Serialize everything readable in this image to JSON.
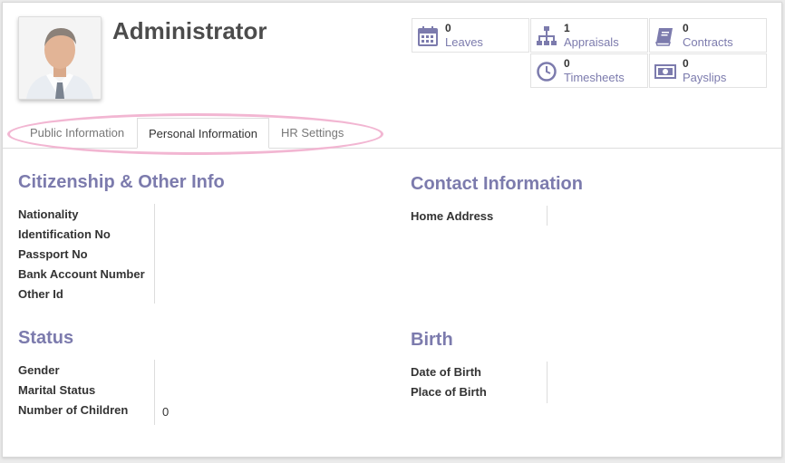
{
  "employee": {
    "name": "Administrator"
  },
  "stats": [
    {
      "count": "0",
      "label": "Leaves",
      "icon": "calendar-icon"
    },
    {
      "count": "1",
      "label": "Appraisals",
      "icon": "org-chart-icon"
    },
    {
      "count": "0",
      "label": "Contracts",
      "icon": "book-icon"
    },
    {
      "count": "0",
      "label": "Timesheets",
      "icon": "clock-icon"
    },
    {
      "count": "0",
      "label": "Payslips",
      "icon": "money-icon"
    }
  ],
  "tabs": [
    {
      "label": "Public Information",
      "active": false
    },
    {
      "label": "Personal Information",
      "active": true
    },
    {
      "label": "HR Settings",
      "active": false
    }
  ],
  "sections": {
    "citizenship": {
      "title": "Citizenship & Other Info",
      "fields": [
        "Nationality",
        "Identification No",
        "Passport No",
        "Bank Account Number",
        "Other Id"
      ]
    },
    "contact": {
      "title": "Contact Information",
      "fields": [
        "Home Address"
      ]
    },
    "status": {
      "title": "Status",
      "fields": [
        "Gender",
        "Marital Status",
        "Number of Children"
      ],
      "children_value": "0"
    },
    "birth": {
      "title": "Birth",
      "fields": [
        "Date of Birth",
        "Place of Birth"
      ]
    }
  },
  "colors": {
    "accent": "#7c7bad",
    "highlight": "#f2b6d2"
  }
}
